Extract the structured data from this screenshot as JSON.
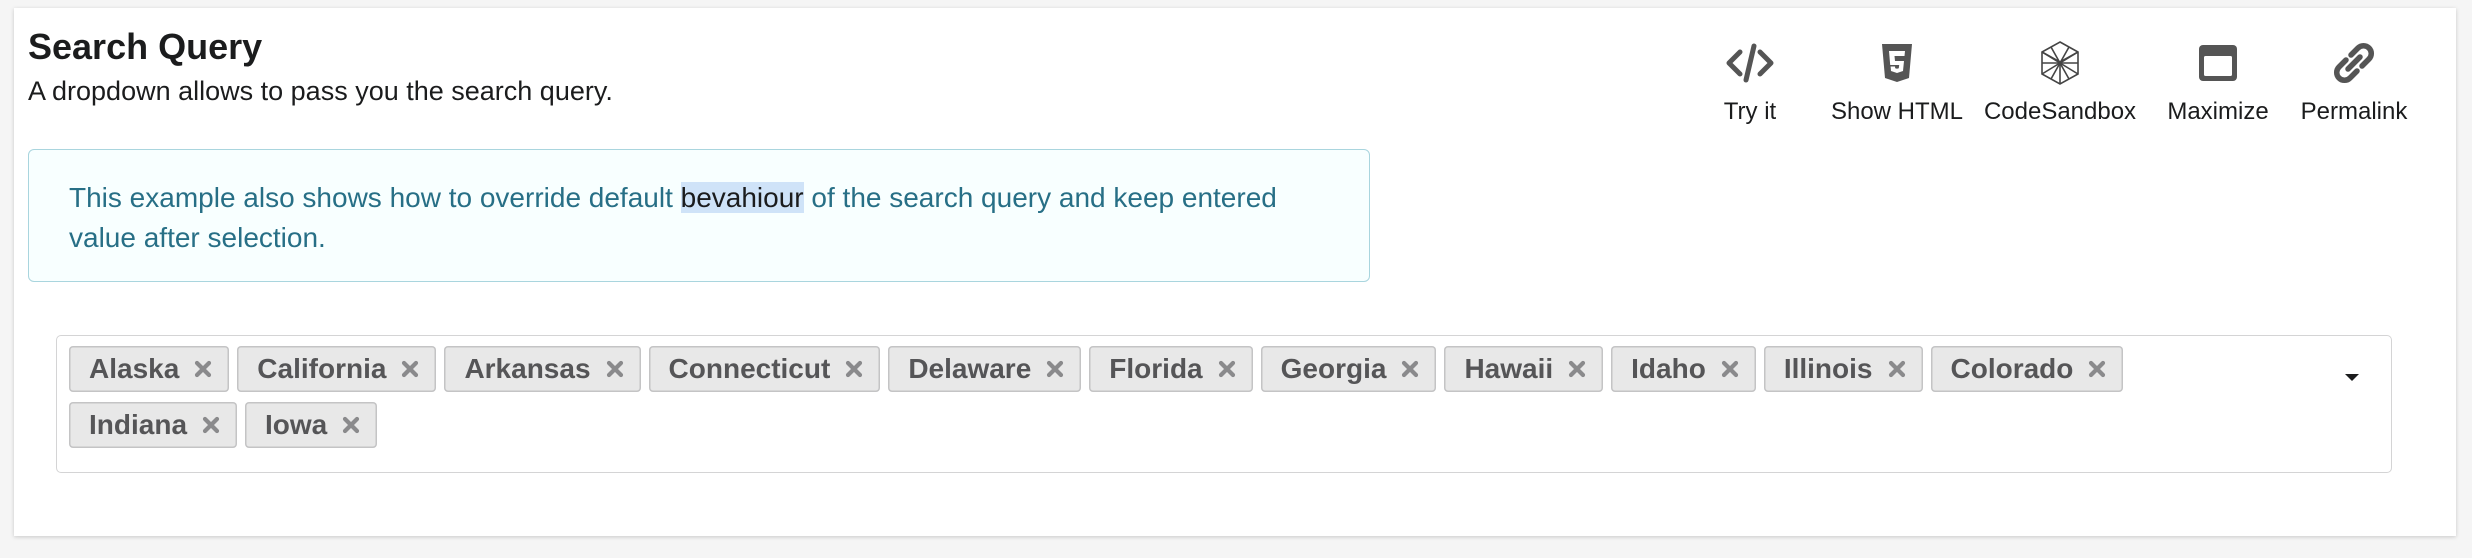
{
  "header": {
    "title": "Search Query",
    "subtitle": "A dropdown allows to pass you the search query."
  },
  "toolbar": {
    "items": [
      {
        "label": "Try it",
        "icon": "code-icon"
      },
      {
        "label": "Show HTML",
        "icon": "html5-icon"
      },
      {
        "label": "CodeSandbox",
        "icon": "codesandbox-icon"
      },
      {
        "label": "Maximize",
        "icon": "maximize-icon"
      },
      {
        "label": "Permalink",
        "icon": "link-icon"
      }
    ]
  },
  "info": {
    "text_before": "This example also shows how to override default ",
    "highlighted": "bevahiour",
    "text_after": " of the search query and keep entered value after selection."
  },
  "dropdown": {
    "selected": [
      "Alaska",
      "California",
      "Arkansas",
      "Connecticut",
      "Delaware",
      "Florida",
      "Georgia",
      "Hawaii",
      "Idaho",
      "Illinois",
      "Colorado",
      "Indiana",
      "Iowa"
    ],
    "remove_icon": "close-icon",
    "caret_icon": "caret-down-icon"
  },
  "colors": {
    "info_text": "#276f86",
    "info_bg": "#f8ffff",
    "info_border": "#a9d5de",
    "chip_bg": "#e8e8e8",
    "chip_text": "#555557"
  }
}
